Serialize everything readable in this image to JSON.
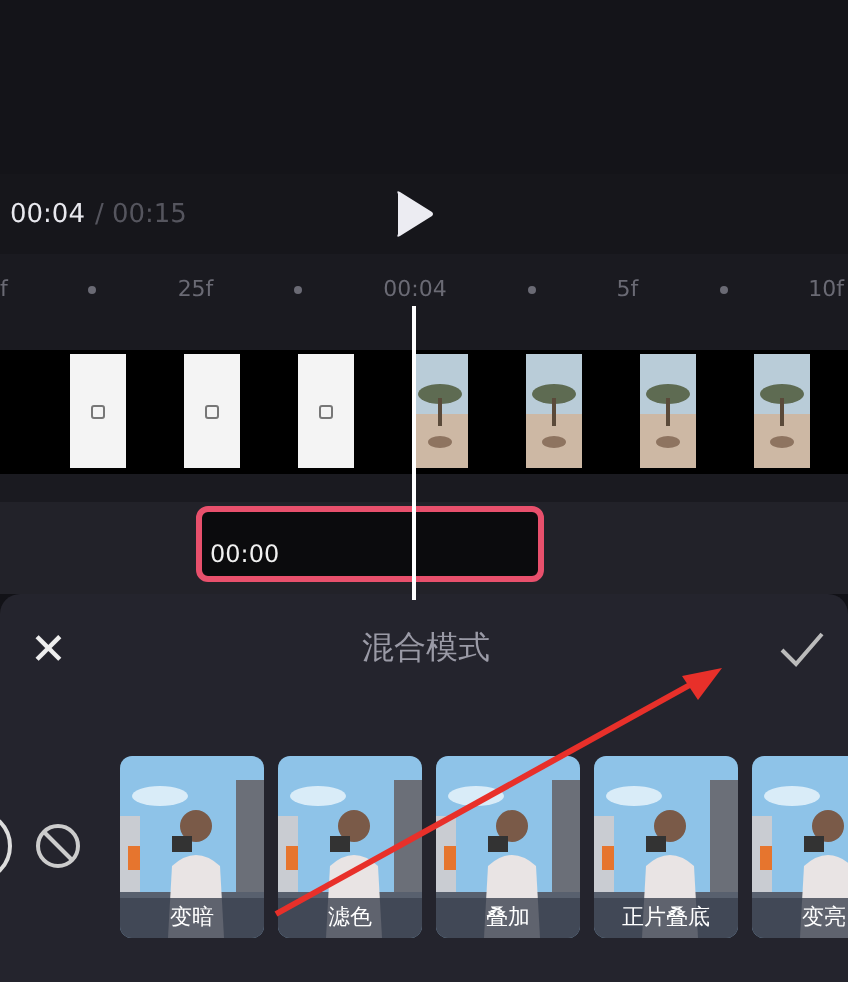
{
  "player": {
    "current_time": "00:04",
    "total_time": "/ 00:15"
  },
  "ruler": [
    "f",
    "25f",
    "00:04",
    "5f",
    "10f"
  ],
  "filmstrip": [
    {
      "kind": "title-card"
    },
    {
      "kind": "title-card"
    },
    {
      "kind": "title-card"
    },
    {
      "kind": "landscape"
    },
    {
      "kind": "landscape"
    },
    {
      "kind": "landscape"
    },
    {
      "kind": "landscape"
    }
  ],
  "overlay_clip": {
    "time": "00:00",
    "selected": true
  },
  "panel": {
    "close": "✕",
    "title": "混合模式"
  },
  "blend_modes": [
    {
      "label": "变暗"
    },
    {
      "label": "滤色"
    },
    {
      "label": "叠加"
    },
    {
      "label": "正片叠底"
    },
    {
      "label": "变亮"
    }
  ]
}
